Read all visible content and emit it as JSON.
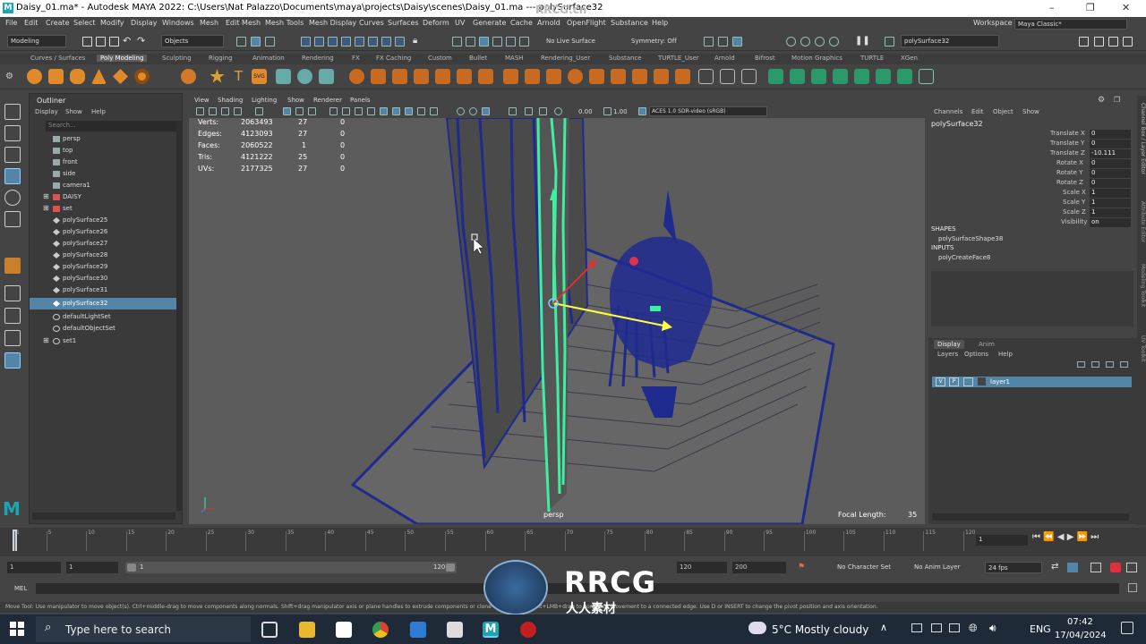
{
  "window": {
    "title": "Daisy_01.ma* - Autodesk MAYA 2022: C:\\Users\\Nat Palazzo\\Documents\\maya\\projects\\Daisy\\scenes\\Daisy_01.ma  ---  polySurface32",
    "watermark": "RRCG.cn"
  },
  "menubar": [
    "File",
    "Edit",
    "Create",
    "Select",
    "Modify",
    "Display",
    "Windows",
    "Mesh",
    "Edit Mesh",
    "Mesh Tools",
    "Mesh Display",
    "Curves",
    "Surfaces",
    "Deform",
    "UV",
    "Generate",
    "Cache",
    "Arnold",
    "OpenFlight",
    "Substance",
    "Help"
  ],
  "workspace": {
    "label": "Workspace :",
    "value": "Maya Classic*"
  },
  "statusline": {
    "mode": "Modeling",
    "objects": "Objects",
    "live_surface": "No Live Surface",
    "symmetry": "Symmetry: Off",
    "object_field": "polySurface32"
  },
  "shelf_tabs": [
    "Curves / Surfaces",
    "Poly Modeling",
    "Sculpting",
    "Rigging",
    "Animation",
    "Rendering",
    "FX",
    "FX Caching",
    "Custom",
    "Bullet",
    "MASH",
    "Rendering_User",
    "Substance",
    "TURTLE_User",
    "Arnold",
    "Bifrost",
    "Motion Graphics",
    "TURTLE",
    "XGen"
  ],
  "shelf_active": "Poly Modeling",
  "outliner": {
    "title": "Outliner",
    "menu": [
      "Display",
      "Show",
      "Help"
    ],
    "search_placeholder": "Search...",
    "items": [
      {
        "label": "persp",
        "type": "camera"
      },
      {
        "label": "top",
        "type": "camera"
      },
      {
        "label": "front",
        "type": "camera"
      },
      {
        "label": "side",
        "type": "camera"
      },
      {
        "label": "camera1",
        "type": "camera"
      },
      {
        "label": "DAISY",
        "type": "group"
      },
      {
        "label": "set",
        "type": "group"
      },
      {
        "label": "polySurface25",
        "type": "mesh"
      },
      {
        "label": "polySurface26",
        "type": "mesh"
      },
      {
        "label": "polySurface27",
        "type": "mesh"
      },
      {
        "label": "polySurface28",
        "type": "mesh"
      },
      {
        "label": "polySurface29",
        "type": "mesh"
      },
      {
        "label": "polySurface30",
        "type": "mesh"
      },
      {
        "label": "polySurface31",
        "type": "mesh"
      },
      {
        "label": "polySurface32",
        "type": "mesh",
        "selected": true
      },
      {
        "label": "defaultLightSet",
        "type": "set"
      },
      {
        "label": "defaultObjectSet",
        "type": "set"
      },
      {
        "label": "set1",
        "type": "set"
      }
    ]
  },
  "viewport": {
    "menu": [
      "View",
      "Shading",
      "Lighting",
      "Show",
      "Renderer",
      "Panels"
    ],
    "exposure": "0.00",
    "gamma": "1.00",
    "color_space": "ACES 1.0 SDR-video (sRGB)",
    "camera_label": "persp",
    "focal_label": "Focal Length:",
    "focal_value": "35",
    "hud": [
      {
        "label": "Verts:",
        "total": "2063493",
        "sel": "27",
        "comp": "0"
      },
      {
        "label": "Edges:",
        "total": "4123093",
        "sel": "27",
        "comp": "0"
      },
      {
        "label": "Faces:",
        "total": "2060522",
        "sel": "1",
        "comp": "0"
      },
      {
        "label": "Tris:",
        "total": "4121222",
        "sel": "25",
        "comp": "0"
      },
      {
        "label": "UVs:",
        "total": "2177325",
        "sel": "27",
        "comp": "0"
      }
    ]
  },
  "channelbox": {
    "menu": [
      "Channels",
      "Edit",
      "Object",
      "Show"
    ],
    "object": "polySurface32",
    "channels": [
      {
        "name": "Translate X",
        "value": "0"
      },
      {
        "name": "Translate Y",
        "value": "0"
      },
      {
        "name": "Translate Z",
        "value": "-10.111"
      },
      {
        "name": "Rotate X",
        "value": "0"
      },
      {
        "name": "Rotate Y",
        "value": "0"
      },
      {
        "name": "Rotate Z",
        "value": "0"
      },
      {
        "name": "Scale X",
        "value": "1"
      },
      {
        "name": "Scale Y",
        "value": "1"
      },
      {
        "name": "Scale Z",
        "value": "1"
      },
      {
        "name": "Visibility",
        "value": "on"
      }
    ],
    "shapes_header": "SHAPES",
    "shape": "polySurfaceShape38",
    "inputs_header": "INPUTS",
    "input": "polyCreateFace8",
    "side_tabs": [
      "Channel Box / Layer Editor",
      "Attribute Editor",
      "Modeling Toolkit",
      "UV Toolkit"
    ]
  },
  "layers": {
    "tabs": [
      "Display",
      "Anim"
    ],
    "menu": [
      "Layers",
      "Options",
      "Help"
    ],
    "layer": {
      "v": "V",
      "p": "P",
      "name": "layer1"
    }
  },
  "timeline": {
    "ticks": [
      "1",
      "5",
      "10",
      "15",
      "20",
      "25",
      "30",
      "35",
      "40",
      "45",
      "50",
      "55",
      "60",
      "65",
      "70",
      "75",
      "80",
      "85",
      "90",
      "95",
      "100",
      "105",
      "110",
      "115",
      "120"
    ],
    "current_frame": "1"
  },
  "range": {
    "start": "1",
    "playback_start": "1",
    "slider_start": "1",
    "slider_end": "120",
    "playback_end": "120",
    "end": "200",
    "character_set": "No Character Set",
    "anim_layer": "No Anim Layer",
    "fps": "24 fps"
  },
  "cmdline": {
    "label": "MEL"
  },
  "helpline": "Move Tool: Use manipulator to move object(s). Ctrl+middle-drag to move components along normals. Shift+drag manipulator axis or plane handles to extrude components or clone objects. Ctrl+Shift+LMB+drag to constrain movement to a connected edge. Use D or INSERT to change the pivot position and axis orientation.",
  "taskbar": {
    "search_placeholder": "Type here to search",
    "weather": "5°C  Mostly cloudy",
    "language": "ENG",
    "time": "07:42",
    "date": "17/04/2024"
  },
  "overlay_brand": {
    "big": "RRCG",
    "small": "人人素材"
  },
  "colors": {
    "selection": "#5285a6",
    "wire": "#1f2a8f",
    "highlight": "#3df0a0",
    "accent": "#1aa6b5"
  }
}
